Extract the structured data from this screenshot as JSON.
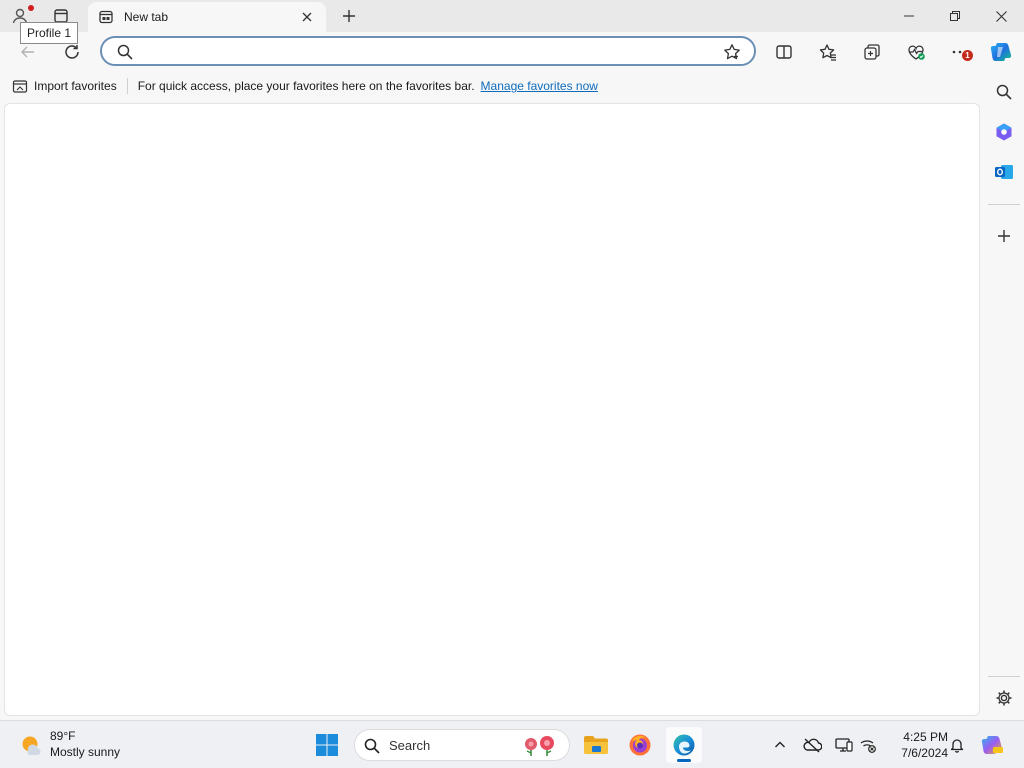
{
  "titlebar": {
    "profile_tooltip": "Profile 1",
    "tab": {
      "title": "New tab"
    }
  },
  "toolbar": {
    "address": {
      "value": "",
      "placeholder": ""
    },
    "more_badge_count": "1"
  },
  "favorites_bar": {
    "import_label": "Import favorites",
    "message": "For quick access, place your favorites here on the favorites bar.",
    "manage_link": "Manage favorites now"
  },
  "taskbar": {
    "weather": {
      "temp": "89°F",
      "condition": "Mostly sunny"
    },
    "search_label": "Search",
    "clock": {
      "time": "4:25 PM",
      "date": "7/6/2024"
    }
  },
  "colors": {
    "accent": "#0f6cbd",
    "address_border": "#6b8fb5",
    "badge": "#c42b1c",
    "taskbar_indicator": "#0067c0"
  },
  "icons": {
    "titlebar": [
      "profile-icon",
      "tab-actions-icon",
      "new-tab-page-icon",
      "close-icon",
      "plus-icon",
      "minimize-icon",
      "restore-icon",
      "close-window-icon"
    ],
    "toolbar": [
      "back-arrow-icon",
      "refresh-icon",
      "search-icon",
      "star-icon",
      "split-screen-icon",
      "favorites-icon",
      "collections-icon",
      "browser-essentials-icon",
      "more-icon",
      "copilot-icon"
    ],
    "sidebar": [
      "search-icon",
      "copilot-icon",
      "outlook-icon",
      "plus-icon",
      "gear-icon"
    ],
    "taskbar": [
      "weather-sun-icon",
      "windows-start-icon",
      "search-icon",
      "file-explorer-icon",
      "firefox-icon",
      "edge-icon",
      "chevron-up-icon",
      "onedrive-icon",
      "display-icon",
      "network-icon",
      "bell-icon",
      "copilot-icon"
    ]
  }
}
